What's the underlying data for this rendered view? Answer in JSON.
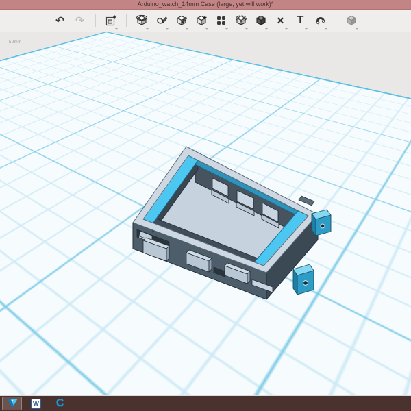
{
  "window": {
    "title": "Arduino_watch_14mm Case (large, yet will work)*"
  },
  "toolbar": {
    "tools": [
      {
        "id": "undo",
        "enabled": true
      },
      {
        "id": "redo",
        "enabled": false
      },
      {
        "id": "insert-primitive",
        "enabled": true
      },
      {
        "id": "transform",
        "enabled": true
      },
      {
        "id": "sketch",
        "enabled": true
      },
      {
        "id": "edit-solid",
        "enabled": true
      },
      {
        "id": "construct",
        "enabled": true
      },
      {
        "id": "pattern",
        "enabled": true
      },
      {
        "id": "group",
        "enabled": true
      },
      {
        "id": "combine",
        "enabled": true
      },
      {
        "id": "delete",
        "enabled": true
      },
      {
        "id": "text",
        "enabled": true
      },
      {
        "id": "snap",
        "enabled": true
      },
      {
        "id": "material-view",
        "enabled": true
      }
    ],
    "delete_glyph": "✕",
    "text_glyph": "T",
    "undo_glyph": "↶",
    "redo_glyph": "↷"
  },
  "canvas": {
    "grid_unit_label": "50mm",
    "model_name": "Arduino watch 14mm case",
    "colors": {
      "grid_minor": "#cdeaf5",
      "grid_major": "#7ecbe7",
      "grid_edge": "#58bfe5",
      "rim_top": "#cdd8e3",
      "accent_cyan": "#4cc7f1",
      "accent_teal": "#2e93bb",
      "body_dark": "#47535e",
      "floor": "#c6d2de"
    }
  },
  "taskbar": {
    "items": [
      {
        "id": "design-app",
        "label": ""
      },
      {
        "id": "word",
        "label": "W"
      },
      {
        "id": "c-app",
        "label": "C"
      }
    ]
  }
}
